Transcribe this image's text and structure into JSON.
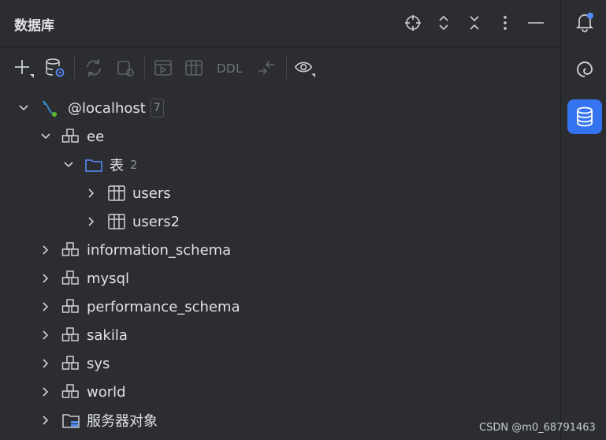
{
  "header": {
    "title": "数据库",
    "icons": [
      "crosshair-icon",
      "expand-vertical-icon",
      "collapse-vertical-icon",
      "more-vertical-icon",
      "minimize-icon"
    ]
  },
  "toolbar": {
    "ddl_label": "DDL",
    "icons": [
      "add-icon",
      "datasource-settings-icon",
      "refresh-icon",
      "jump-to-query-console-icon",
      "query-console-icon",
      "table-view-icon",
      "compare-icon",
      "view-options-icon"
    ]
  },
  "tree": {
    "root": {
      "label": "@localhost",
      "badge": "7"
    },
    "schema_ee": {
      "label": "ee"
    },
    "folder_tables": {
      "label": "表",
      "count": "2"
    },
    "table_users": {
      "label": "users"
    },
    "table_users2": {
      "label": "users2"
    },
    "schema_information_schema": {
      "label": "information_schema"
    },
    "schema_mysql": {
      "label": "mysql"
    },
    "schema_performance_schema": {
      "label": "performance_schema"
    },
    "schema_sakila": {
      "label": "sakila"
    },
    "schema_sys": {
      "label": "sys"
    },
    "schema_world": {
      "label": "world"
    },
    "server_objects": {
      "label": "服务器对象"
    }
  },
  "rightbar": {
    "icons": [
      "notifications-icon",
      "ai-assistant-icon",
      "database-icon"
    ],
    "active_color": "#3574f0",
    "notification_dot_color": "#548af7"
  },
  "watermark": "CSDN @m0_68791463",
  "colors": {
    "background": "#2b2d30",
    "text": "#dfe1e5",
    "muted": "#8c8f94",
    "folder_blue": "#548af7",
    "mysql_blue": "#3d8fd1",
    "connected_green": "#5fb832"
  }
}
